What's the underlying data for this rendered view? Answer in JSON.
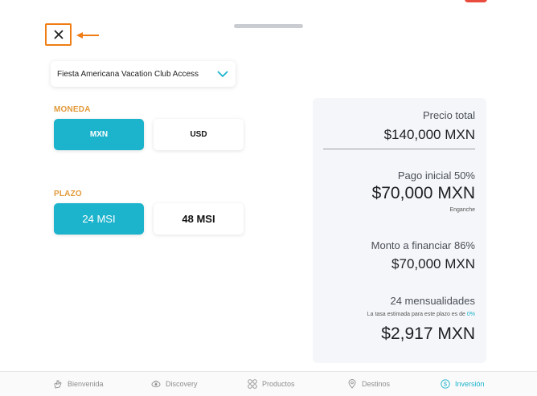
{
  "header": {
    "close_icon": "close-icon",
    "arrow_color": "#f07d14"
  },
  "product_select": {
    "value": "Fiesta Americana Vacation Club Access"
  },
  "currency": {
    "label": "MONEDA",
    "options": [
      "MXN",
      "USD"
    ],
    "selected": "MXN"
  },
  "term": {
    "label": "PLAZO",
    "options": [
      "24 MSI",
      "48 MSI"
    ],
    "selected": "24 MSI"
  },
  "summary": {
    "total_caption": "Precio total",
    "total_value": "$140,000 MXN",
    "down_caption": "Pago inicial 50%",
    "down_value": "$70,000 MXN",
    "down_sub": "Enganche",
    "finance_caption": "Monto a financiar 86%",
    "finance_value": "$70,000 MXN",
    "installments_caption": "24 mensualidades",
    "rate_note": "La tasa estimada para este plazo es de",
    "rate_value": "0%",
    "installment_value": "$2,917 MXN"
  },
  "tabs": [
    {
      "label": "Bienvenida",
      "icon": "hand-icon"
    },
    {
      "label": "Discovery",
      "icon": "eye-icon"
    },
    {
      "label": "Productos",
      "icon": "grid-icon"
    },
    {
      "label": "Destinos",
      "icon": "pin-icon"
    },
    {
      "label": "Inversión",
      "icon": "dollar-icon",
      "active": true
    }
  ],
  "colors": {
    "accent": "#1cb3cc",
    "section_label": "#e29a3a",
    "highlight": "#f07d14"
  }
}
